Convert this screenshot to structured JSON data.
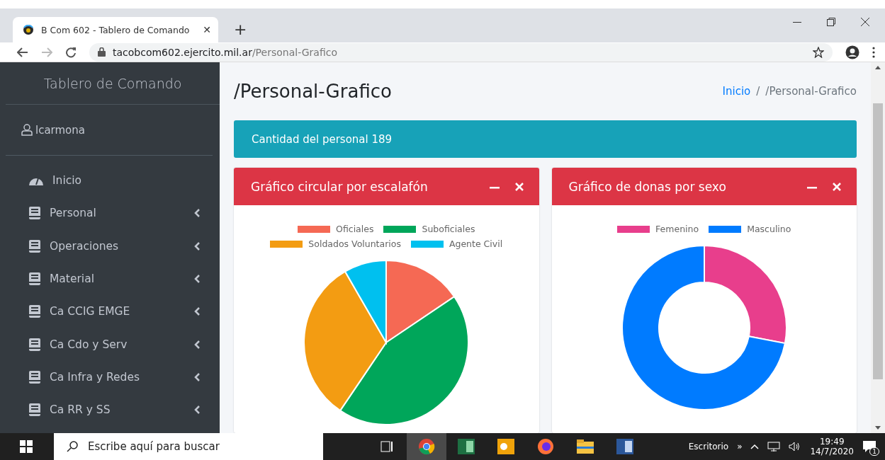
{
  "browser": {
    "tab_title": "B Com 602 - Tablero de Comando",
    "tab_close": "✕",
    "new_tab": "+",
    "url_host": "tacobcom602.ejercito.mil.ar",
    "url_path": "/Personal-Grafico"
  },
  "sidebar": {
    "brand": "Tablero de Comando",
    "user": "lcarmona",
    "items": [
      {
        "label": "Inicio",
        "kind": "dashboard",
        "expandable": false
      },
      {
        "label": "Personal",
        "kind": "book",
        "expandable": true
      },
      {
        "label": "Operaciones",
        "kind": "book",
        "expandable": true
      },
      {
        "label": "Material",
        "kind": "book",
        "expandable": true
      },
      {
        "label": "Ca CCIG EMGE",
        "kind": "book",
        "expandable": true
      },
      {
        "label": "Ca Cdo y Serv",
        "kind": "book",
        "expandable": true
      },
      {
        "label": "Ca Infra y Redes",
        "kind": "book",
        "expandable": true
      },
      {
        "label": "Ca RR y SS",
        "kind": "book",
        "expandable": true
      }
    ]
  },
  "page": {
    "title": "/Personal-Grafico",
    "breadcrumb": [
      {
        "label": "Inicio",
        "link": true
      },
      {
        "label": "/Personal-Grafico",
        "link": false
      }
    ],
    "separator": "/"
  },
  "banner": {
    "text": "Cantidad del personal 189"
  },
  "cards": [
    {
      "title": "Gráfico circular por escalafón",
      "kind": "pie",
      "legend": [
        {
          "label": "Oficiales",
          "color": "#f56954"
        },
        {
          "label": "Suboficiales",
          "color": "#00a65a"
        },
        {
          "label": "Soldados Voluntarios",
          "color": "#f39c12"
        },
        {
          "label": "Agente Civil",
          "color": "#00c0ef"
        }
      ]
    },
    {
      "title": "Gráfico de donas por sexo",
      "kind": "donut",
      "legend": [
        {
          "label": "Femenino",
          "color": "#e83e8c"
        },
        {
          "label": "Masculino",
          "color": "#007bff"
        }
      ]
    }
  ],
  "taskbar": {
    "search_placeholder": "Escribe aquí para buscar",
    "desktop": "Escritorio",
    "chevron": "»",
    "time": "19:49",
    "date": "14/7/2020",
    "notifications": "1"
  }
}
